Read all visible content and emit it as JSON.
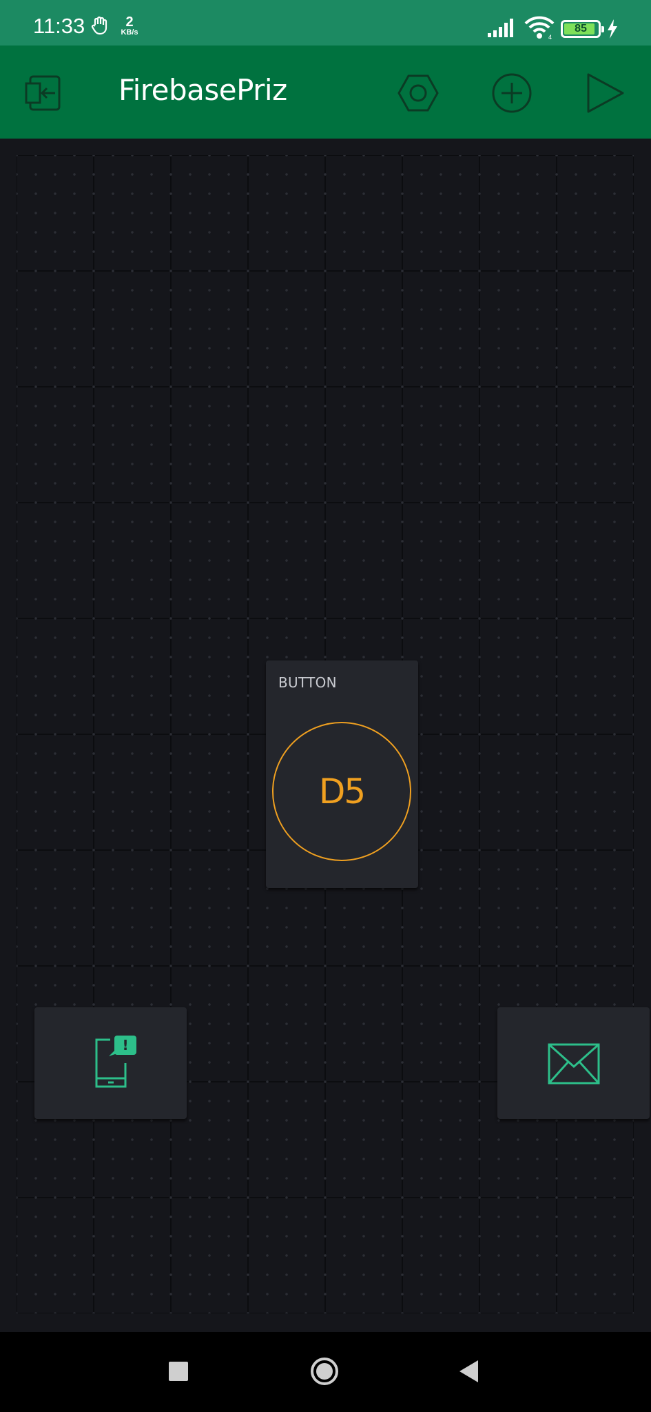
{
  "status_bar": {
    "time": "11:33",
    "net_speed_value": "2",
    "net_speed_unit": "KB/s",
    "battery_level": "85",
    "icons": [
      "hand-icon",
      "signal-icon",
      "wifi-icon",
      "battery-icon",
      "charging-bolt-icon"
    ]
  },
  "app_bar": {
    "title": "FirebasePriz",
    "icons": [
      "exit-icon",
      "settings-hexagon-icon",
      "add-circle-icon",
      "play-icon"
    ]
  },
  "widgets": {
    "button": {
      "label": "BUTTON",
      "pin": "D5",
      "accent": "#f0a020"
    },
    "notification": {
      "icon": "phone-notification-icon",
      "accent": "#2dbf8a"
    },
    "email": {
      "icon": "envelope-icon",
      "accent": "#2dbf8a"
    }
  },
  "nav_bar": {
    "icons": [
      "recents-square-icon",
      "home-circle-icon",
      "back-triangle-icon"
    ]
  },
  "colors": {
    "status_bar_bg": "#1c8a62",
    "app_bar_bg": "#00723f",
    "canvas_bg": "#15161b",
    "widget_bg": "#24262c"
  }
}
